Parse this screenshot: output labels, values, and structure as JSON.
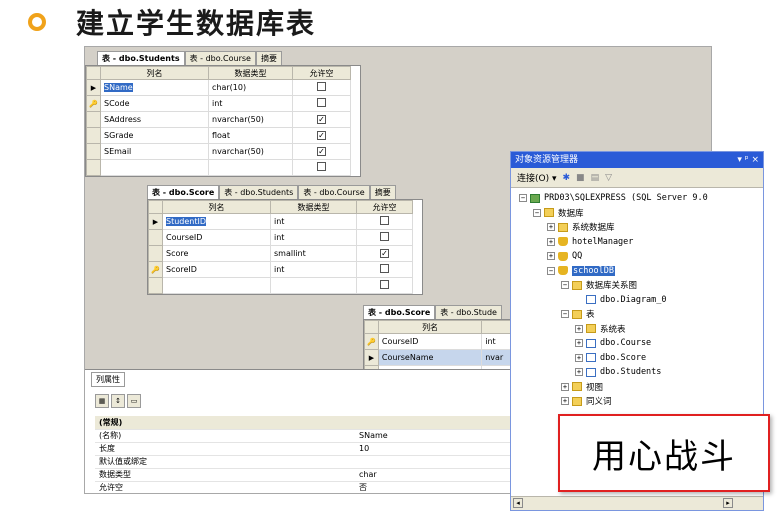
{
  "slide": {
    "title": "建立学生数据库表",
    "bullet_color": "#f0a21a"
  },
  "students": {
    "tabs": [
      "表 - dbo.Students",
      "表 - dbo.Course",
      "摘要"
    ],
    "headers": [
      "列名",
      "数据类型",
      "允许空"
    ],
    "rows": [
      {
        "marker": "▶",
        "name": "SName",
        "type": "char(10)",
        "nullable": ""
      },
      {
        "marker": "🔑",
        "name": "SCode",
        "type": "int",
        "nullable": ""
      },
      {
        "marker": "",
        "name": "SAddress",
        "type": "nvarchar(50)",
        "nullable": "✓"
      },
      {
        "marker": "",
        "name": "SGrade",
        "type": "float",
        "nullable": "✓"
      },
      {
        "marker": "",
        "name": "SEmail",
        "type": "nvarchar(50)",
        "nullable": "✓"
      },
      {
        "marker": "",
        "name": "",
        "type": "",
        "nullable": ""
      }
    ]
  },
  "score": {
    "tabs": [
      "表 - dbo.Score",
      "表 - dbo.Students",
      "表 - dbo.Course",
      "摘要"
    ],
    "headers": [
      "列名",
      "数据类型",
      "允许空"
    ],
    "rows": [
      {
        "marker": "▶",
        "name": "StudentID",
        "type": "int",
        "nullable": ""
      },
      {
        "marker": "",
        "name": "CourseID",
        "type": "int",
        "nullable": ""
      },
      {
        "marker": "",
        "name": "Score",
        "type": "smallint",
        "nullable": "✓"
      },
      {
        "marker": "🔑",
        "name": "ScoreID",
        "type": "int",
        "nullable": ""
      },
      {
        "marker": "",
        "name": "",
        "type": "",
        "nullable": ""
      }
    ]
  },
  "score2": {
    "tabs": [
      "表 - dbo.Score",
      "表 - dbo.Stude"
    ],
    "headers": [
      "列名",
      ""
    ],
    "rows": [
      {
        "marker": "🔑",
        "name": "CourseID",
        "type": "int"
      },
      {
        "marker": "▶",
        "name": "CourseName",
        "type": "nvar"
      },
      {
        "marker": "",
        "name": "",
        "type": ""
      }
    ]
  },
  "props": {
    "tab": "列属性",
    "category": "(常规)",
    "rows": [
      {
        "k": "(名称)",
        "v": "SName"
      },
      {
        "k": "长度",
        "v": "10"
      },
      {
        "k": "默认值或绑定",
        "v": ""
      },
      {
        "k": "数据类型",
        "v": "char"
      },
      {
        "k": "允许空",
        "v": "否"
      }
    ]
  },
  "explorer": {
    "title": "对象资源管理器",
    "title_buttons": "▾ ᵖ ×",
    "connect": "连接(O) ▾",
    "tree": [
      {
        "lvl": 0,
        "exp": "−",
        "icon": "srv",
        "label": "PRD03\\SQLEXPRESS (SQL Server 9.0"
      },
      {
        "lvl": 1,
        "exp": "−",
        "icon": "folder",
        "label": "数据库"
      },
      {
        "lvl": 2,
        "exp": "+",
        "icon": "folder",
        "label": "系统数据库"
      },
      {
        "lvl": 2,
        "exp": "+",
        "icon": "db",
        "label": "hotelManager"
      },
      {
        "lvl": 2,
        "exp": "+",
        "icon": "db",
        "label": "QQ"
      },
      {
        "lvl": 2,
        "exp": "−",
        "icon": "db",
        "label": "schoolDB",
        "selected": true
      },
      {
        "lvl": 3,
        "exp": "−",
        "icon": "folder",
        "label": "数据库关系图"
      },
      {
        "lvl": 4,
        "exp": "",
        "icon": "tbl",
        "label": "dbo.Diagram_0"
      },
      {
        "lvl": 3,
        "exp": "−",
        "icon": "folder",
        "label": "表"
      },
      {
        "lvl": 4,
        "exp": "+",
        "icon": "folder",
        "label": "系统表"
      },
      {
        "lvl": 4,
        "exp": "+",
        "icon": "tbl",
        "label": "dbo.Course"
      },
      {
        "lvl": 4,
        "exp": "+",
        "icon": "tbl",
        "label": "dbo.Score"
      },
      {
        "lvl": 4,
        "exp": "+",
        "icon": "tbl",
        "label": "dbo.Students"
      },
      {
        "lvl": 3,
        "exp": "+",
        "icon": "folder",
        "label": "视图"
      },
      {
        "lvl": 3,
        "exp": "+",
        "icon": "folder",
        "label": "同义词"
      }
    ]
  },
  "callout": {
    "text": "用心战斗",
    "border_color": "#e02020"
  }
}
